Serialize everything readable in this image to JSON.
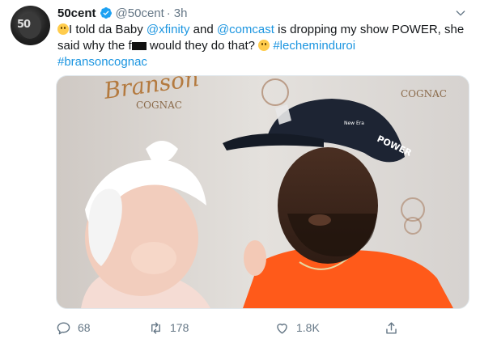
{
  "user": {
    "name": "50cent",
    "handle": "@50cent",
    "separator": "·",
    "time": "3h",
    "avatar_text": "50"
  },
  "tweet": {
    "text_1": "I told da Baby ",
    "mention_1": "@xfinity",
    "text_2": " and ",
    "mention_2": "@comcast",
    "text_3": " is dropping my show POWER, she said why the f",
    "text_4": " would they do that? ",
    "hashtag_1": "#lecheminduroi",
    "hashtag_2": "#bransoncognac"
  },
  "media": {
    "banner_brand": "Branson",
    "banner_sub": "COGNAC",
    "banner_sub_right": "COGNAC",
    "cap_text": "POWER",
    "cap_logo": "New Era"
  },
  "actions": {
    "replies": "68",
    "retweets": "178",
    "likes": "1.8K"
  },
  "colors": {
    "link": "#1b95e0",
    "muted": "#657786",
    "verified": "#1da1f2",
    "shirt": "#ff5a1a"
  },
  "icons": {
    "verified": "verified-badge-icon",
    "caret": "chevron-down-icon",
    "reply": "reply-icon",
    "retweet": "retweet-icon",
    "like": "heart-icon",
    "share": "share-icon"
  }
}
